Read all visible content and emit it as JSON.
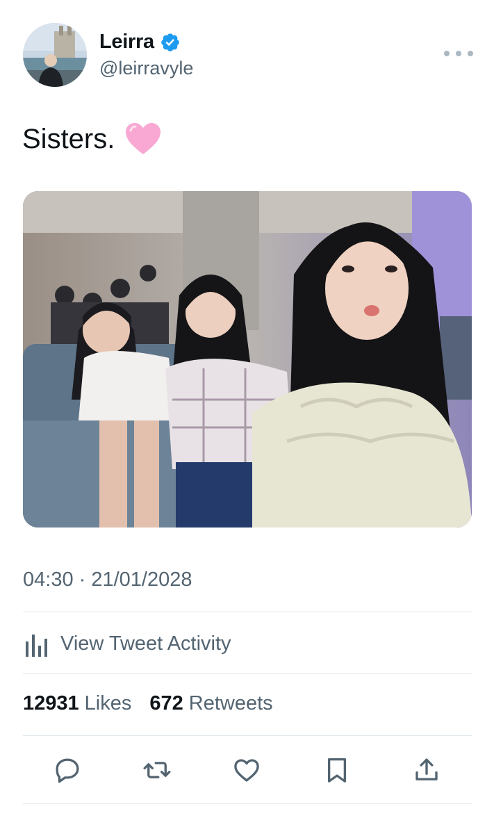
{
  "user": {
    "display_name": "Leirra",
    "handle": "@leirravyle",
    "verified": true,
    "verified_color": "#1d9bf0"
  },
  "menu": {
    "icon": "more-horizontal-icon"
  },
  "tweet": {
    "text": "Sisters.",
    "emoji": "pink-heart-icon",
    "timestamp": "04:30 · 21/01/2028"
  },
  "activity": {
    "label": "View Tweet Activity",
    "icon": "bar-chart-icon"
  },
  "stats": {
    "likes_count": "12931",
    "likes_label": "Likes",
    "retweets_count": "672",
    "retweets_label": "Retweets"
  },
  "actions": [
    {
      "name": "reply",
      "icon": "reply-icon"
    },
    {
      "name": "retweet",
      "icon": "retweet-icon"
    },
    {
      "name": "like",
      "icon": "heart-icon"
    },
    {
      "name": "bookmark",
      "icon": "bookmark-icon"
    },
    {
      "name": "share",
      "icon": "share-icon"
    }
  ],
  "colors": {
    "text_primary": "#0f1419",
    "text_secondary": "#536471",
    "divider": "#e1e8ed",
    "heart_pink": "#f9a8d4"
  }
}
